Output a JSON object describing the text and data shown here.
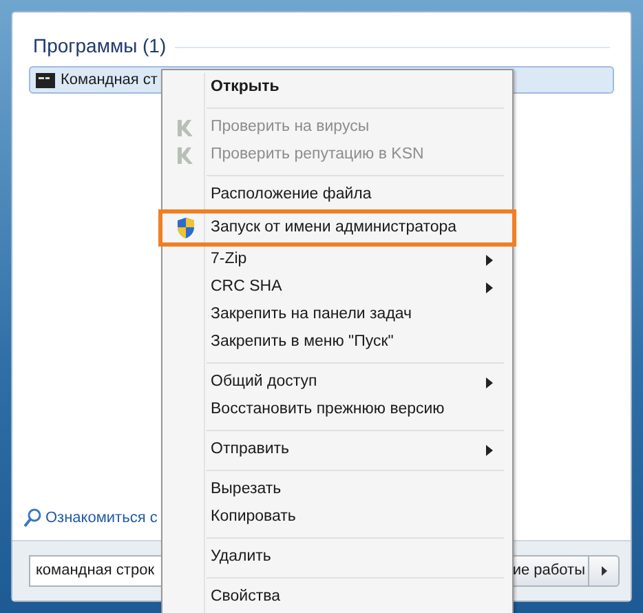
{
  "programs": {
    "heading": "Программы (1)",
    "result": {
      "label": "Командная ст",
      "selected": true
    }
  },
  "more_link": "Ознакомиться с",
  "search": {
    "value": "командная строк"
  },
  "shutdown_button": {
    "label": "ие работы"
  },
  "context_menu": [
    {
      "kind": "default",
      "label": "Открыть",
      "disabled": false,
      "submenu": false,
      "highlighted": false
    },
    {
      "kind": "separator"
    },
    {
      "kind": "antivirus",
      "label": "Проверить на вирусы",
      "disabled": true,
      "submenu": false,
      "highlighted": false
    },
    {
      "kind": "antivirus",
      "label": "Проверить репутацию в KSN",
      "disabled": true,
      "submenu": false,
      "highlighted": false
    },
    {
      "kind": "separator"
    },
    {
      "kind": "plain",
      "label": "Расположение файла",
      "disabled": false,
      "submenu": false,
      "highlighted": false
    },
    {
      "kind": "admin",
      "label": "Запуск от имени администратора",
      "disabled": false,
      "submenu": false,
      "highlighted": true
    },
    {
      "kind": "plain",
      "label": "7-Zip",
      "disabled": false,
      "submenu": true,
      "highlighted": false
    },
    {
      "kind": "plain",
      "label": "CRC SHA",
      "disabled": false,
      "submenu": true,
      "highlighted": false
    },
    {
      "kind": "plain",
      "label": "Закрепить на панели задач",
      "disabled": false,
      "submenu": false,
      "highlighted": false
    },
    {
      "kind": "plain",
      "label": "Закрепить в меню \"Пуск\"",
      "disabled": false,
      "submenu": false,
      "highlighted": false
    },
    {
      "kind": "separator"
    },
    {
      "kind": "plain",
      "label": "Общий доступ",
      "disabled": false,
      "submenu": true,
      "highlighted": false
    },
    {
      "kind": "plain",
      "label": "Восстановить прежнюю версию",
      "disabled": false,
      "submenu": false,
      "highlighted": false
    },
    {
      "kind": "separator"
    },
    {
      "kind": "plain",
      "label": "Отправить",
      "disabled": false,
      "submenu": true,
      "highlighted": false
    },
    {
      "kind": "separator"
    },
    {
      "kind": "plain",
      "label": "Вырезать",
      "disabled": false,
      "submenu": false,
      "highlighted": false
    },
    {
      "kind": "plain",
      "label": "Копировать",
      "disabled": false,
      "submenu": false,
      "highlighted": false
    },
    {
      "kind": "separator"
    },
    {
      "kind": "plain",
      "label": "Удалить",
      "disabled": false,
      "submenu": false,
      "highlighted": false
    },
    {
      "kind": "separator"
    },
    {
      "kind": "plain",
      "label": "Свойства",
      "disabled": false,
      "submenu": false,
      "highlighted": false
    }
  ]
}
